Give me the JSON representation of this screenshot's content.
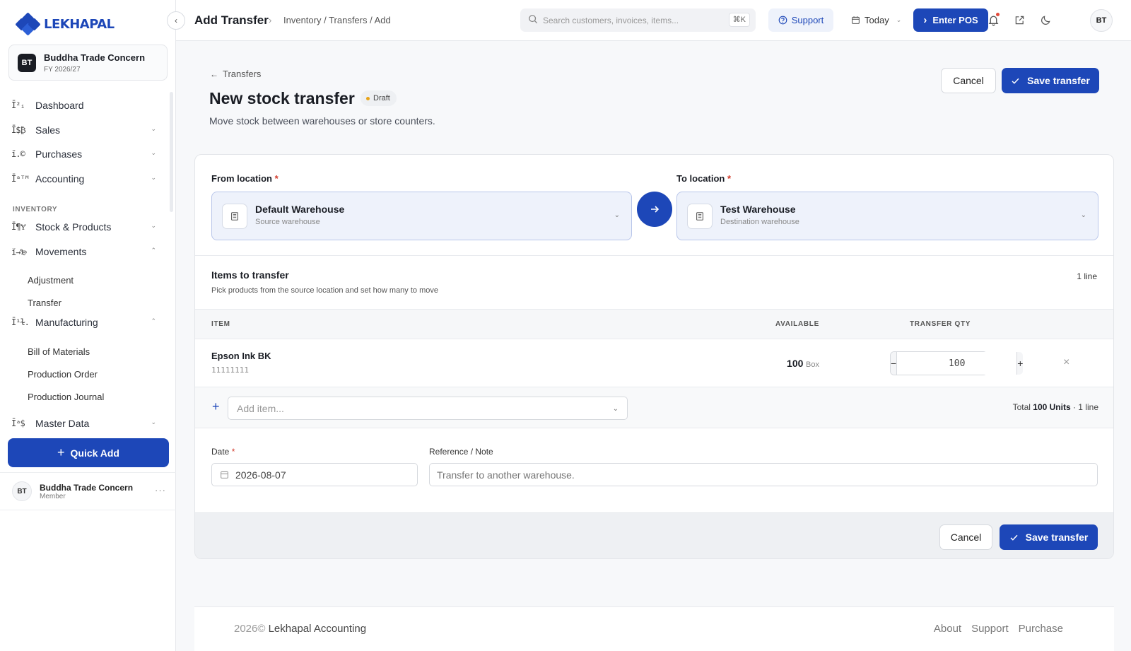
{
  "brand": {
    "name": "LEKHAPAL",
    "primary_color": "#1d47b8"
  },
  "org": {
    "initials": "BT",
    "name": "Buddha Trade Concern",
    "fy": "FY 2026/27"
  },
  "nav": {
    "dashboard": "Dashboard",
    "sales": "Sales",
    "purchases": "Purchases",
    "accounting": "Accounting",
    "section_inventory": "INVENTORY",
    "stock_products": "Stock & Products",
    "movements": "Movements",
    "adjustment": "Adjustment",
    "transfer": "Transfer",
    "manufacturing": "Manufacturing",
    "bill_of_materials": "Bill of Materials",
    "production_order": "Production Order",
    "production_journal": "Production Journal",
    "master_data": "Master Data"
  },
  "quick_add": "Quick Add",
  "user": {
    "initials": "BT",
    "name": "Buddha Trade Concern",
    "role": "Member"
  },
  "topbar": {
    "title": "Add Transfer",
    "breadcrumb": "Inventory / Transfers / Add",
    "search_placeholder": "Search customers, invoices, items...",
    "search_shortcut": "⌘K",
    "support": "Support",
    "today": "Today",
    "enter_pos": "Enter POS",
    "avatar": "BT"
  },
  "header": {
    "back": "Transfers",
    "title": "New stock transfer",
    "status": "Draft",
    "subtitle": "Move stock between warehouses or store counters.",
    "cancel": "Cancel",
    "save": "Save transfer"
  },
  "locations": {
    "from_label": "From location",
    "from_name": "Default Warehouse",
    "from_sub": "Source warehouse",
    "to_label": "To location",
    "to_name": "Test Warehouse",
    "to_sub": "Destination warehouse",
    "required_mark": "*"
  },
  "items": {
    "title": "Items to transfer",
    "subtitle": "Pick products from the source location and set how many to move",
    "line_count": "1 line",
    "columns": {
      "item": "ITEM",
      "available": "AVAILABLE",
      "qty": "TRANSFER QTY"
    },
    "rows": [
      {
        "name": "Epson Ink BK",
        "sku": "11111111",
        "available": "100",
        "unit": "Box",
        "qty": "100"
      }
    ],
    "add_placeholder": "Add item...",
    "total_prefix": "Total",
    "total_value": "100 Units",
    "total_suffix": "· 1 line"
  },
  "form": {
    "date_label": "Date",
    "date_value": "2026-08-07",
    "note_label": "Reference / Note",
    "note_placeholder": "Transfer to another warehouse."
  },
  "footer_actions": {
    "cancel": "Cancel",
    "save": "Save transfer"
  },
  "page_footer": {
    "year": "2026©",
    "company": "Lekhapal Accounting",
    "links": [
      "About",
      "Support",
      "Purchase"
    ]
  }
}
